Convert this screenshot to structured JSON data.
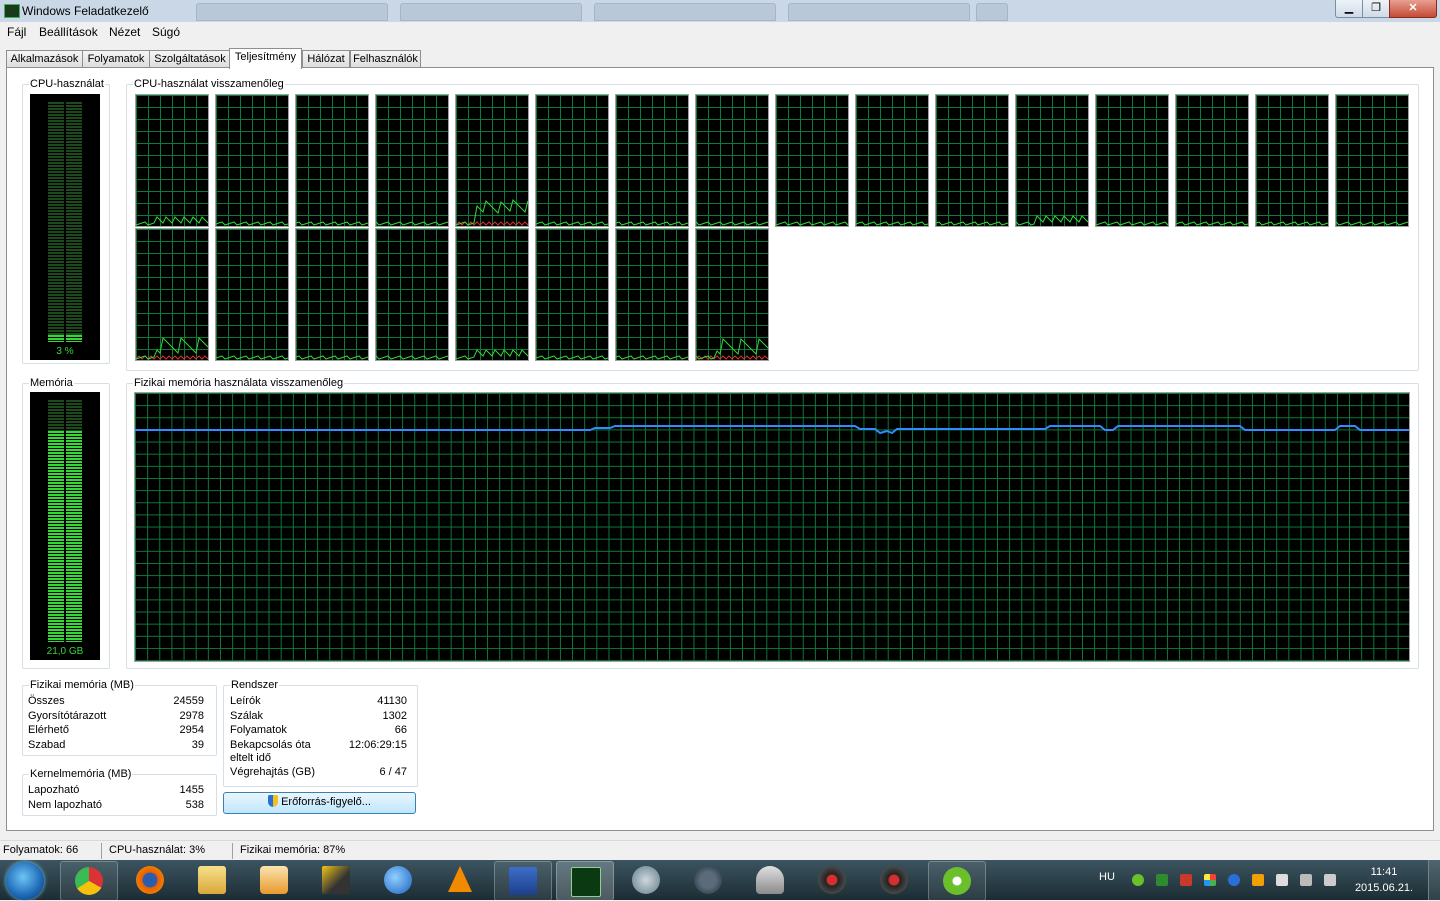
{
  "window": {
    "title": "Windows Feladatkezelő"
  },
  "menu": [
    "Fájl",
    "Beállítások",
    "Nézet",
    "Súgó"
  ],
  "tabs": [
    "Alkalmazások",
    "Folyamatok",
    "Szolgáltatások",
    "Teljesítmény",
    "Hálózat",
    "Felhasználók"
  ],
  "active_tab": "Teljesítmény",
  "cpu": {
    "usage_label": "CPU-használat",
    "history_label": "CPU-használat visszamenőleg",
    "usage_value": "3 %",
    "usage_fraction": 0.03,
    "core_count": 24
  },
  "memory": {
    "label": "Memória",
    "history_label": "Fizikai memória használata visszamenőleg",
    "value": "21,0 GB",
    "usage_fraction": 0.87
  },
  "physical_memory": {
    "title": "Fizikai memória (MB)",
    "rows": [
      {
        "k": "Összes",
        "v": "24559"
      },
      {
        "k": "Gyorsítótárazott",
        "v": "2978"
      },
      {
        "k": "Elérhető",
        "v": "2954"
      },
      {
        "k": "Szabad",
        "v": "39"
      }
    ]
  },
  "kernel_memory": {
    "title": "Kernelmemória (MB)",
    "rows": [
      {
        "k": "Lapozható",
        "v": "1455"
      },
      {
        "k": "Nem lapozható",
        "v": "538"
      }
    ]
  },
  "system": {
    "title": "Rendszer",
    "rows": [
      {
        "k": "Leírók",
        "v": "41130"
      },
      {
        "k": "Szálak",
        "v": "1302"
      },
      {
        "k": "Folyamatok",
        "v": "66"
      },
      {
        "k": "Bekapcsolás óta",
        "v": "12:06:29:15"
      },
      {
        "k": "eltelt idő",
        "v": ""
      },
      {
        "k": "Végrehajtás (GB)",
        "v": "6 / 47"
      }
    ]
  },
  "resource_monitor_button": "Erőforrás-figyelő...",
  "statusbar": {
    "processes": "Folyamatok: 66",
    "cpu": "CPU-használat: 3%",
    "memory": "Fizikai memória: 87%"
  },
  "taskbar": {
    "lang": "HU",
    "time": "11:41",
    "date": "2015.06.21.",
    "apps": [
      "chrome-icon",
      "firefox-icon",
      "explorer-icon",
      "media-player-icon",
      "winamp-icon",
      "thunderbird-icon",
      "vlc-icon",
      "save-disk-icon",
      "task-manager-icon",
      "globe-icon",
      "screen-icon",
      "bell-icon",
      "rec-icon",
      "rec2-icon",
      "utorrent-icon"
    ]
  },
  "colors": {
    "graph_line": "#35d935",
    "grid": "#0c7a3a",
    "memory_line": "#2f8cff",
    "kernel_line": "#d93030"
  }
}
